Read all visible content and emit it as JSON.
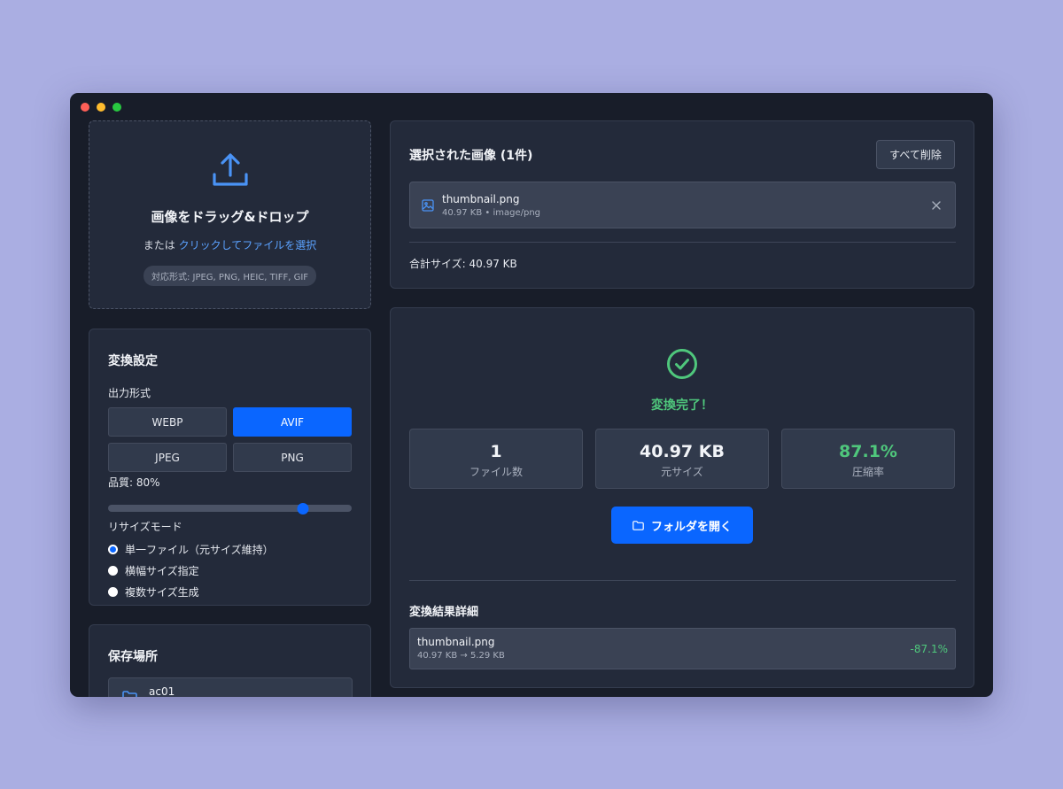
{
  "dropzone": {
    "title": "画像をドラッグ&ドロップ",
    "subtitle_prefix": "または",
    "link": "クリックしてファイルを選択",
    "formats": "対応形式: JPEG, PNG, HEIC, TIFF, GIF"
  },
  "settings": {
    "title": "変換設定",
    "output_format_label": "出力形式",
    "formats": [
      "WEBP",
      "AVIF",
      "JPEG",
      "PNG"
    ],
    "selected_format": "AVIF",
    "quality_label": "品質: 80%",
    "quality_value": 80,
    "resize_label": "リサイズモード",
    "resize_options": [
      "単一ファイル（元サイズ維持）",
      "横幅サイズ指定",
      "複数サイズ生成"
    ],
    "resize_selected_index": 0
  },
  "save": {
    "title": "保存場所",
    "folder_name": "ac01"
  },
  "selected": {
    "title": "選択された画像 (1件)",
    "clear_button": "すべて削除",
    "file": {
      "name": "thumbnail.png",
      "meta": "40.97 KB • image/png"
    },
    "total": "合計サイズ: 40.97 KB"
  },
  "result": {
    "status": "変換完了！",
    "stats": [
      {
        "value": "1",
        "label": "ファイル数"
      },
      {
        "value": "40.97 KB",
        "label": "元サイズ"
      },
      {
        "value": "87.1%",
        "label": "圧縮率"
      }
    ],
    "open_button": "フォルダを開く",
    "details_title": "変換結果詳細",
    "detail": {
      "name": "thumbnail.png",
      "sizes": "40.97 KB → 5.29 KB",
      "ratio": "-87.1%"
    }
  },
  "colors": {
    "accent": "#0a66ff",
    "success": "#4fc77c",
    "link": "#5ba2ff"
  }
}
